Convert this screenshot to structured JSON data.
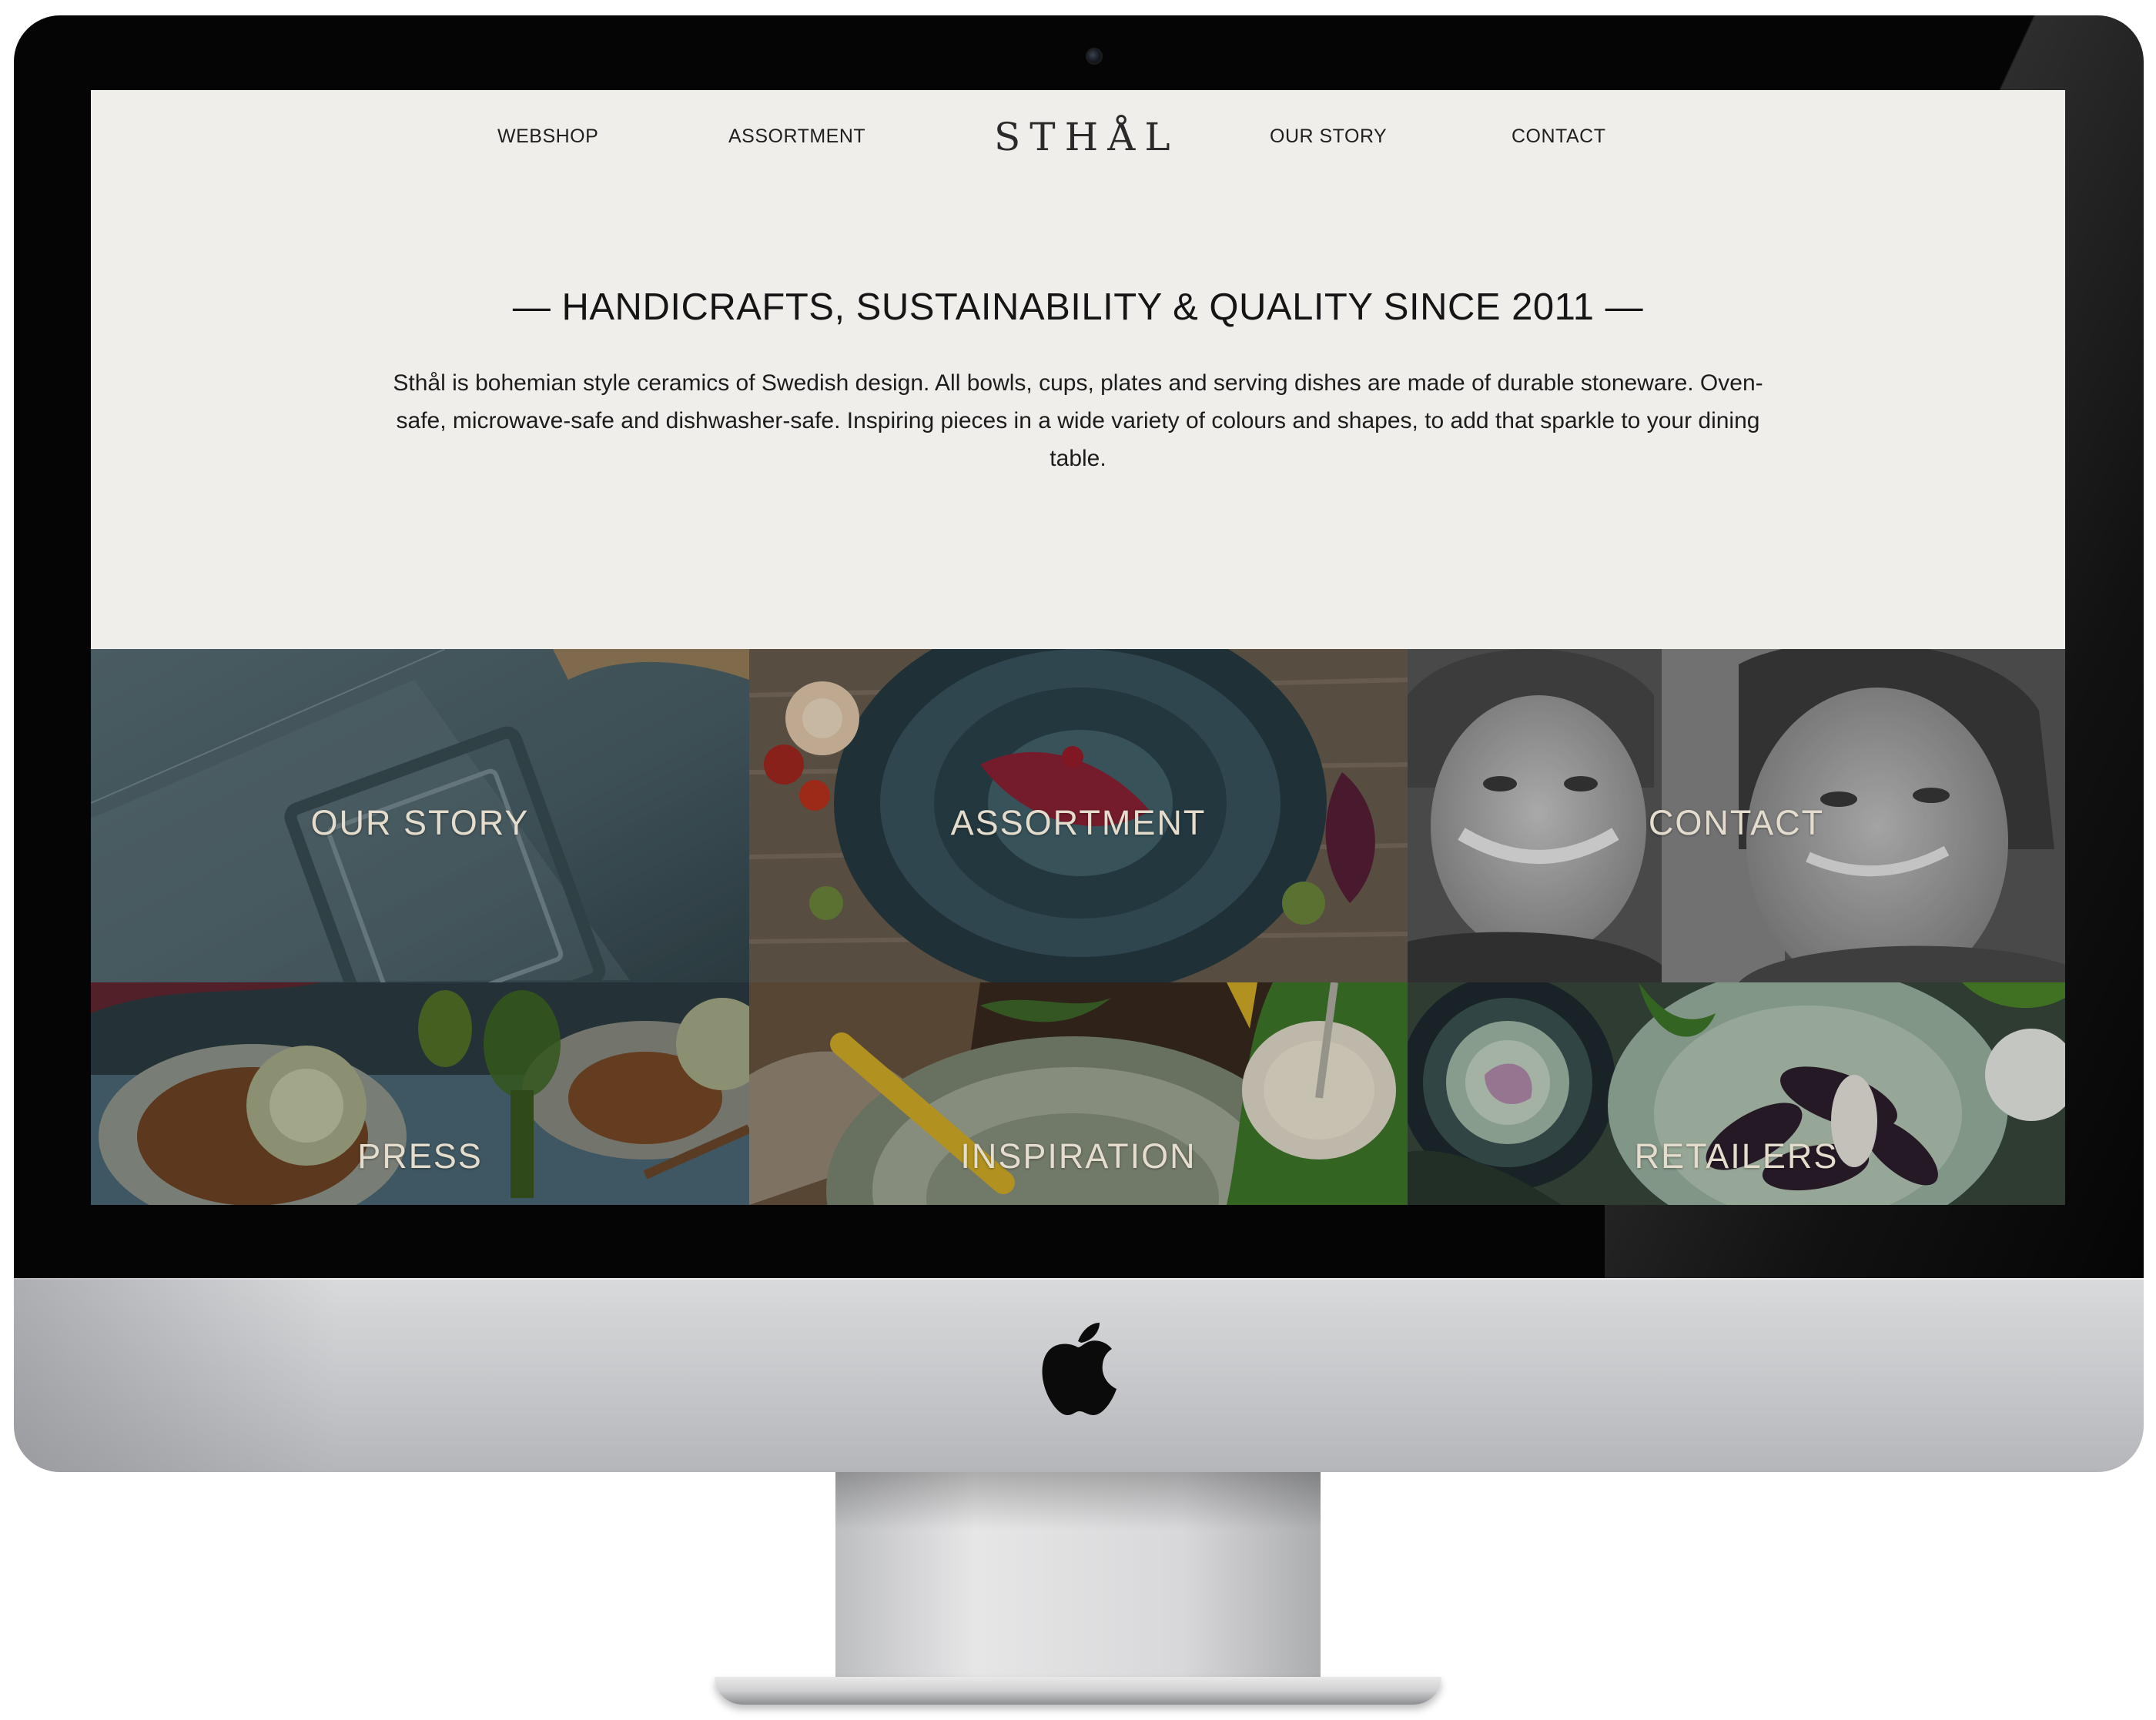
{
  "nav": {
    "links_left": [
      "WEBSHOP",
      "ASSORTMENT"
    ],
    "logo": "STHÅL",
    "links_right": [
      "OUR STORY",
      "CONTACT"
    ]
  },
  "hero": {
    "title": "— HANDICRAFTS, SUSTAINABILITY & QUALITY SINCE 2011 —",
    "text": "Sthål is bohemian style ceramics of Swedish design. All bowls, cups, plates and serving dishes are made of durable stoneware. Oven-safe, microwave-safe and dishwasher-safe. Inspiring pieces in a wide variety of colours and shapes, to add that sparkle to your dining table."
  },
  "tiles": [
    {
      "label": "OUR STORY"
    },
    {
      "label": "ASSORTMENT"
    },
    {
      "label": "CONTACT"
    },
    {
      "label": "PRESS"
    },
    {
      "label": "INSPIRATION"
    },
    {
      "label": "RETAILERS"
    }
  ],
  "colors": {
    "page_bg": "#f0eeea",
    "tile_label": "#e4dccd",
    "bezel": "#050505"
  }
}
